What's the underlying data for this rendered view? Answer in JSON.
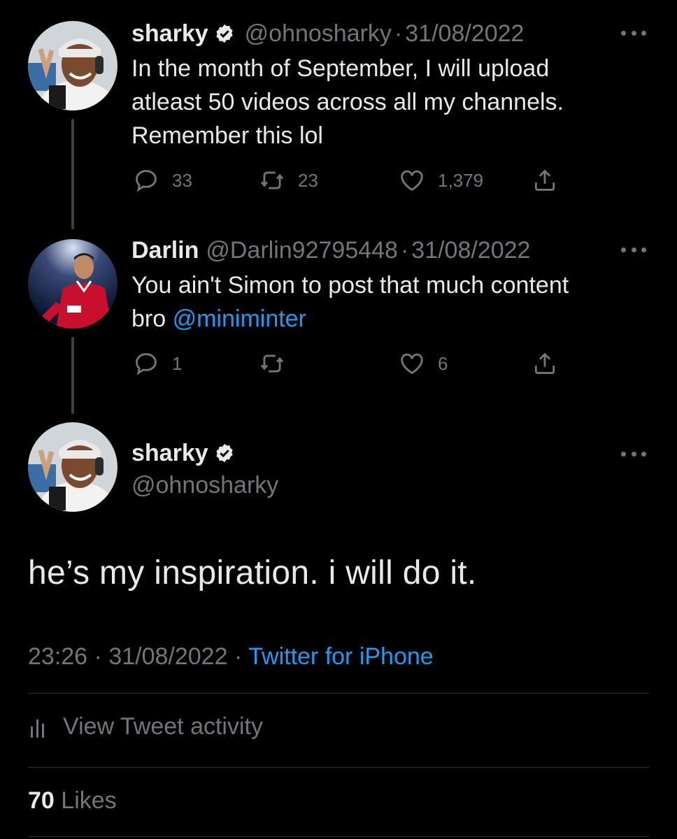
{
  "tweet1": {
    "name": "sharky",
    "handle": "@ohnosharky",
    "separator": "·",
    "date": "31/08/2022",
    "text_lines": [
      "In the month of September, I will upload",
      "atleast 50 videos across all my channels.",
      "Remember this lol"
    ],
    "replies": "33",
    "retweets": "23",
    "likes": "1,379"
  },
  "tweet2": {
    "name": "Darlin",
    "handle": "@Darlin92795448",
    "separator": "·",
    "date": "31/08/2022",
    "text_line1": "You ain't Simon to post that much content",
    "text_line2_prefix": "bro ",
    "mention": "@miniminter",
    "replies": "1",
    "likes": "6"
  },
  "tweet3": {
    "name": "sharky",
    "handle": "@ohnosharky",
    "text": "he’s my inspiration. i will do it.",
    "time": "23:26",
    "separator": "·",
    "date": "31/08/2022",
    "source_separator": "·",
    "source": "Twitter for iPhone",
    "activity_label": "View Tweet activity",
    "likes_count": "70",
    "likes_label": "Likes"
  },
  "colors": {
    "background": "#000000",
    "text": "#e7e9ea",
    "muted": "#71767b",
    "accent": "#1d9bf0"
  },
  "icons": [
    "verified-icon",
    "reply-icon",
    "retweet-icon",
    "like-icon",
    "share-icon",
    "more-icon",
    "activity-icon"
  ]
}
